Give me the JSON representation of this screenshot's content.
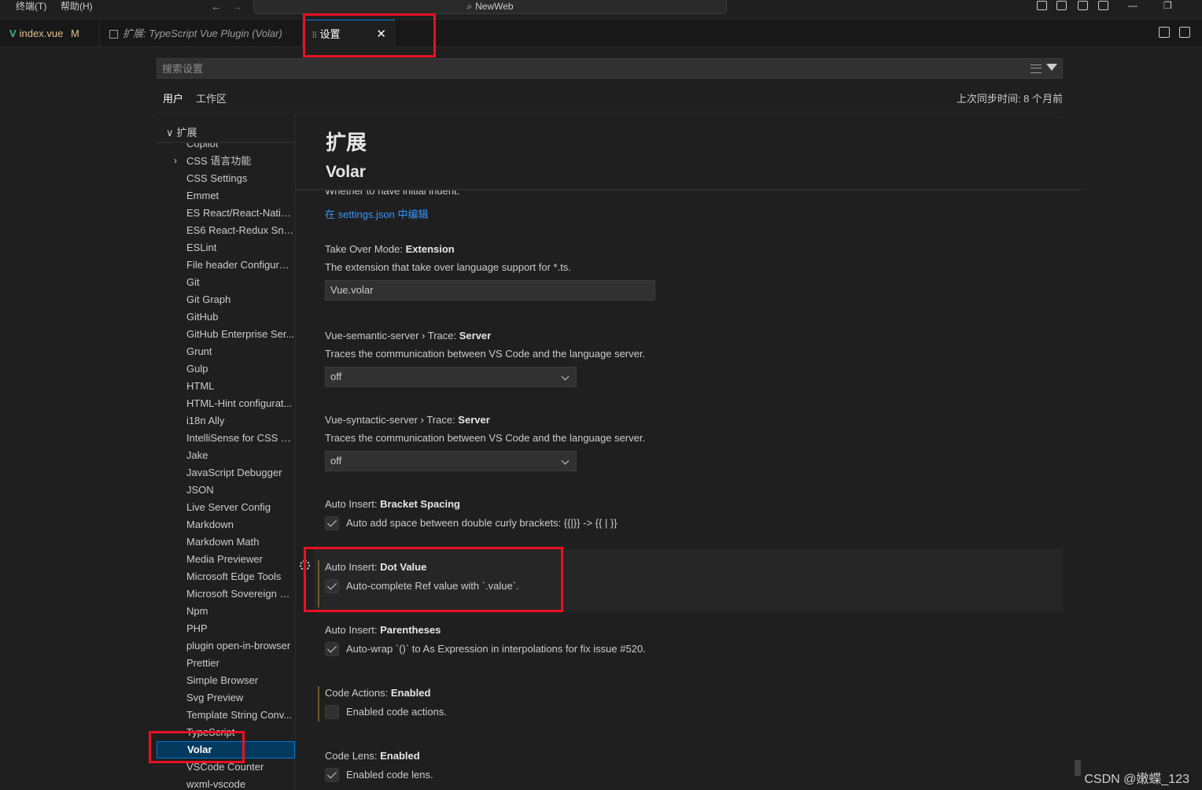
{
  "titlebar": {
    "menus": [
      "终端(T)",
      "帮助(H)"
    ],
    "back": "←",
    "forward": "→",
    "command_center": "NewWeb",
    "window_controls": [
      "—",
      "❐"
    ]
  },
  "tabs": [
    {
      "icon": "V",
      "label": "index.vue",
      "badge": "M"
    },
    {
      "label": "扩展: TypeScript Vue Plugin (Volar)"
    },
    {
      "icon": "⫶⫶",
      "label": "设置",
      "close": "✕",
      "active": true
    }
  ],
  "search": {
    "placeholder": "搜索设置",
    "value": ""
  },
  "scope_tabs": {
    "user": "用户",
    "workspace": "工作区"
  },
  "sync_time": "上次同步时间: 8 个月前",
  "toc": {
    "header": "扩展",
    "chevron": "∨",
    "items": [
      "Copilot",
      "CSS 语言功能",
      "CSS Settings",
      "Emmet",
      "ES React/React-Native...",
      "ES6 React-Redux Snip...",
      "ESLint",
      "File header Configurat...",
      "Git",
      "Git Graph",
      "GitHub",
      "GitHub Enterprise Ser...",
      "Grunt",
      "Gulp",
      "HTML",
      "HTML-Hint configurat...",
      "i18n Ally",
      "IntelliSense for CSS cl...",
      "Jake",
      "JavaScript Debugger",
      "JSON",
      "Live Server Config",
      "Markdown",
      "Markdown Math",
      "Media Previewer",
      "Microsoft Edge Tools",
      "Microsoft Sovereign C...",
      "Npm",
      "PHP",
      "plugin open-in-browser",
      "Prettier",
      "Simple Browser",
      "Svg Preview",
      "Template String Conv...",
      "TypeScript",
      "Volar",
      "VSCode Counter",
      "wxml-vscode"
    ],
    "selected": "Volar",
    "expand_chevron": "›"
  },
  "main": {
    "section_title": "扩展",
    "subsection_title": "Volar",
    "cut_description": "Whether to have initial indent.",
    "edit_link": "在 settings.json 中编辑",
    "settings": [
      {
        "prefix": "Take Over Mode: ",
        "name": "Extension",
        "desc": "The extension that take over language support for *.ts.",
        "type": "text",
        "value": "Vue.volar"
      },
      {
        "prefix": "Vue-semantic-server › Trace: ",
        "name": "Server",
        "desc": "Traces the communication between VS Code and the language server.",
        "type": "select",
        "value": "off"
      },
      {
        "prefix": "Vue-syntactic-server › Trace: ",
        "name": "Server",
        "desc": "Traces the communication between VS Code and the language server.",
        "type": "select",
        "value": "off"
      },
      {
        "prefix": "Auto Insert: ",
        "name": "Bracket Spacing",
        "desc": "Auto add space between double curly brackets: {{|}} -> {{ | }}",
        "type": "checkbox",
        "checked": true
      },
      {
        "prefix": "Auto Insert: ",
        "name": "Dot Value",
        "desc": "Auto-complete Ref value with `.value`.",
        "type": "checkbox",
        "checked": true
      },
      {
        "prefix": "Auto Insert: ",
        "name": "Parentheses",
        "desc": "Auto-wrap `()` to As Expression in interpolations for fix issue #520.",
        "type": "checkbox",
        "checked": true
      },
      {
        "prefix": "Code Actions: ",
        "name": "Enabled",
        "desc": "Enabled code actions.",
        "type": "checkbox",
        "checked": false
      },
      {
        "prefix": "Code Lens: ",
        "name": "Enabled",
        "desc": "Enabled code lens.",
        "type": "checkbox",
        "checked": true
      }
    ]
  },
  "watermark": "CSDN @嫩蝶_123",
  "colors": {
    "accent": "#0078d4",
    "link": "#3794ff",
    "highlight": "#e81123",
    "background": "#1f1f1f"
  }
}
